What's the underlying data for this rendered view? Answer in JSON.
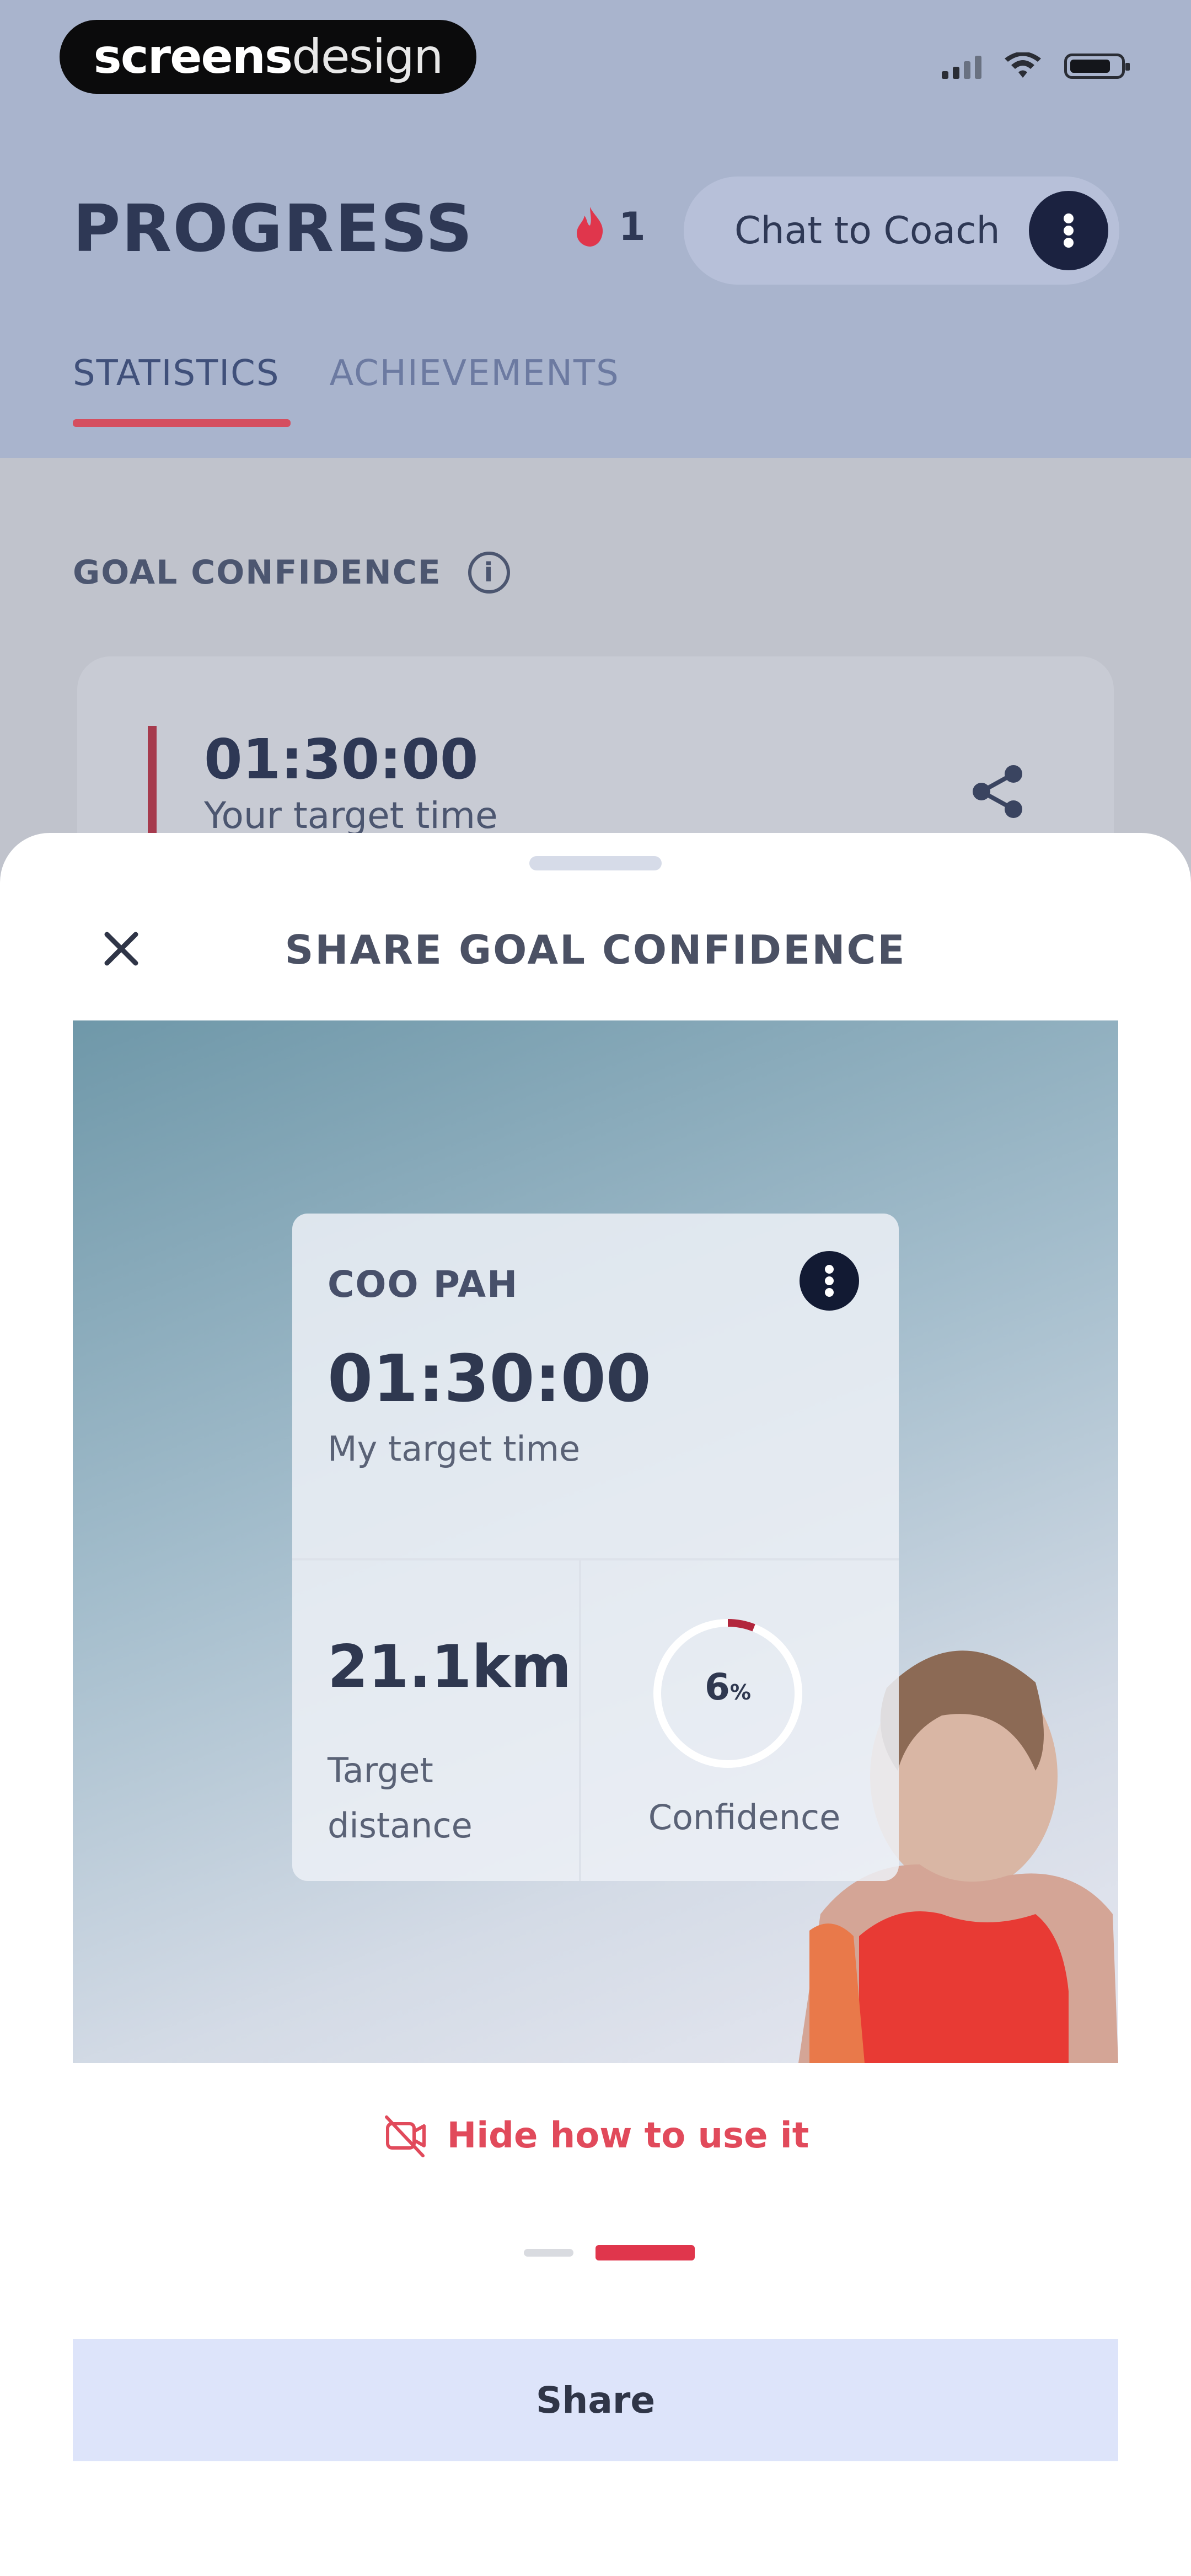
{
  "status_bar": {
    "logo_bold": "screens",
    "logo_light": "design"
  },
  "header": {
    "title": "PROGRESS",
    "streak_count": "1",
    "chat_button": "Chat to Coach"
  },
  "tabs": [
    {
      "label": "STATISTICS",
      "active": true
    },
    {
      "label": "ACHIEVEMENTS",
      "active": false
    }
  ],
  "goal_section": {
    "label": "GOAL CONFIDENCE",
    "target_time": "01:30:00",
    "target_time_label": "Your target time"
  },
  "sheet": {
    "title": "SHARE GOAL CONFIDENCE",
    "card": {
      "brand": "COO PAH",
      "target_time": "01:30:00",
      "target_time_label": "My target time",
      "distance": "21.1km",
      "distance_label": "Target distance",
      "confidence_percent": "6",
      "confidence_unit": "%",
      "confidence_value": 0.06,
      "confidence_label": "Confidence"
    },
    "hide_link": "Hide how to use it",
    "pager": {
      "count": 2,
      "active_index": 1
    },
    "share_button": "Share"
  },
  "colors": {
    "accent": "#e0364c",
    "navy": "#1b2240",
    "button_bg": "#dde4fa"
  }
}
